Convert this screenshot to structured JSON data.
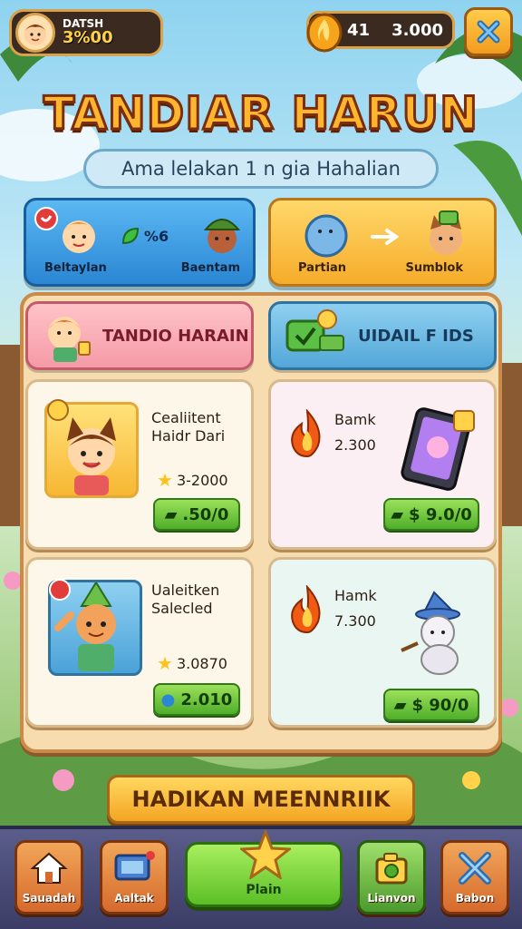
{
  "player": {
    "name": "DATSH",
    "score": "3%00"
  },
  "currency": {
    "value1": "41",
    "value2": "3.000"
  },
  "title": "TANDIAR HARUN",
  "subtitle": "Ama lelakan 1 n gia Hahalian",
  "categories": [
    {
      "left_label": "Beltaylan",
      "right_label": "Baentam",
      "middle": "%6"
    },
    {
      "left_label": "Partian",
      "right_label": "Sumblok"
    }
  ],
  "tabs": [
    {
      "label": "TANDIO HARAIN"
    },
    {
      "label": "UIDAIL F IDS"
    }
  ],
  "items": [
    {
      "name_line1": "Cealiitent",
      "name_line2": "Haidr Dari",
      "stars": "3-2000",
      "price": ".50/0"
    },
    {
      "name_line1": "Bamk",
      "amount": "2.300",
      "price": "$ 9.0/0"
    },
    {
      "name_line1": "Ualeitken",
      "name_line2": "Salecled",
      "stars": "3.0870",
      "price": "2.010"
    },
    {
      "name_line1": "Hamk",
      "amount": "7.300",
      "price": "$ 90/0"
    }
  ],
  "banner": "HADIKAN MEENNRIIK",
  "nav": [
    {
      "label": "Sauadah"
    },
    {
      "label": "Aaltak"
    },
    {
      "label": "Plain"
    },
    {
      "label": "Lianvon"
    },
    {
      "label": "Babon"
    }
  ],
  "colors": {
    "accent": "#f4a523",
    "green_button": "#4fae2a",
    "board": "#f7dcb0"
  }
}
